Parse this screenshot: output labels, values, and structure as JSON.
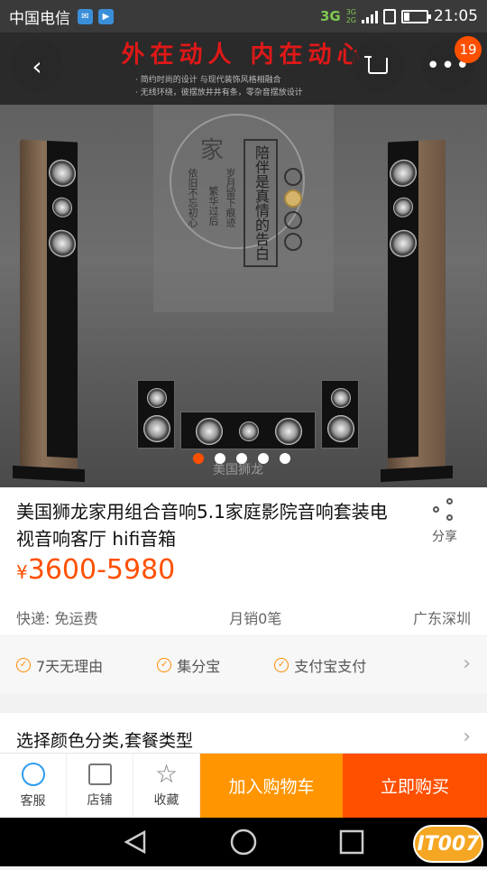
{
  "status_bar": {
    "carrier": "中国电信",
    "network": "3G",
    "network_small_top": "3G",
    "network_small_bottom": "2G",
    "time": "21:05"
  },
  "hero": {
    "slogan": "外在动人   内在动心",
    "feature_line_1": "· 简约时尚的设计  与现代装饰风格相融合",
    "feature_line_2": "· 无线环绕，彼摆放井井有条，零杂音摆放设计",
    "jia": "家",
    "poem_1": "依旧不忘初心",
    "poem_2": "繁华过后",
    "poem_3": "岁月留下痕迹",
    "boxed_text": "陪伴是真情的告白",
    "brand_mark": "美国狮龙",
    "cart_badge": "19",
    "active_slide": 1,
    "slide_count": 5
  },
  "product": {
    "title": "美国狮龙家用组合音响5.1家庭影院音响套装电视音响客厅 hifi音箱",
    "share_label": "分享",
    "currency": "¥",
    "price": "3600-5980",
    "shipping": "快递: 免运费",
    "monthly_sales": "月销0笔",
    "location": "广东深圳"
  },
  "services": [
    {
      "label": "7天无理由"
    },
    {
      "label": "集分宝"
    },
    {
      "label": "支付宝支付"
    }
  ],
  "options": {
    "label": "选择颜色分类,套餐类型"
  },
  "action_bar": {
    "customer_service": "客服",
    "shop": "店铺",
    "favorite": "收藏",
    "add_to_cart": "加入购物车",
    "buy_now": "立即购买"
  },
  "watermark": "IT007",
  "colors": {
    "accent": "#ff5000",
    "cart_button": "#ff9500",
    "service_check": "#ff8a00"
  }
}
